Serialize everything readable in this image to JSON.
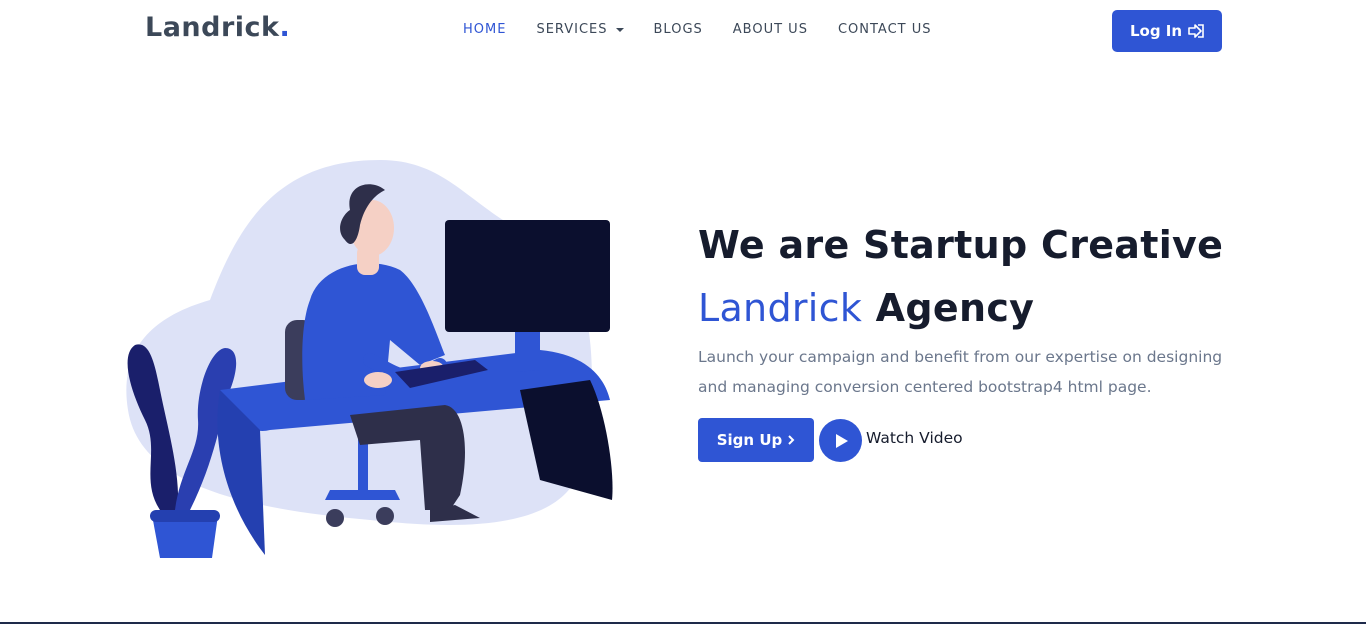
{
  "brand": {
    "name": "Landrick",
    "dot": ".",
    "accent_color": "#2f55d4"
  },
  "nav": {
    "items": [
      {
        "label": "HOME",
        "active": true
      },
      {
        "label": "SERVICES",
        "dropdown": true
      },
      {
        "label": "BLOGS"
      },
      {
        "label": "ABOUT US"
      },
      {
        "label": "CONTACT US"
      }
    ]
  },
  "header": {
    "login_label": "Log In",
    "login_icon": "sign-in-icon"
  },
  "hero": {
    "title_line1": "We are Startup Creative",
    "title_accent": "Landrick",
    "title_rest": " Agency",
    "description": "Launch your campaign and benefit from our expertise on designing and managing conversion centered bootstrap4 html page.",
    "signup_label": "Sign Up",
    "signup_icon": "chevron-right-icon",
    "watch_label": "Watch Video",
    "watch_icon": "play-icon"
  },
  "colors": {
    "primary": "#2f55d4",
    "dark": "#161c2d",
    "muted": "#8492a6"
  }
}
